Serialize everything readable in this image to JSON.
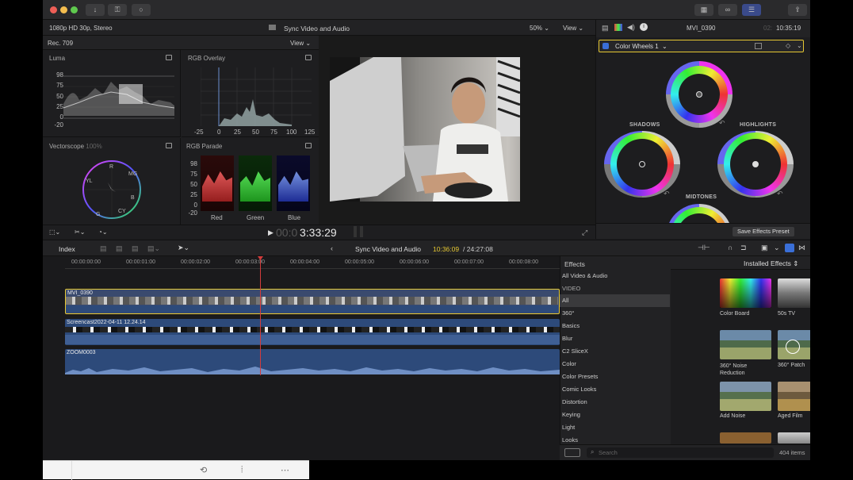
{
  "titlebar": {
    "toolbar_left_icons": [
      "download-icon",
      "key-icon",
      "circle-icon"
    ],
    "toolbar_right_icons": [
      "grid-icon",
      "glasses-icon",
      "sliders-icon",
      "share-icon"
    ]
  },
  "browser": {
    "format_label": "1080p HD 30p, Stereo",
    "project_title": "Sync Video and Audio",
    "zoom_label": "50%",
    "view_label": "View",
    "scopes_colorspace": "Rec. 709",
    "scopes_view_label": "View"
  },
  "scopes": {
    "luma": {
      "title": "Luma",
      "ticks": [
        "98",
        "75",
        "50",
        "25",
        "0",
        "-20"
      ]
    },
    "rgb_overlay": {
      "title": "RGB Overlay",
      "ticks": [
        "-25",
        "0",
        "25",
        "50",
        "75",
        "100",
        "125"
      ]
    },
    "vectorscope": {
      "title": "Vectorscope",
      "zoom": "100%",
      "targets": [
        "R",
        "MG",
        "B",
        "CY",
        "G",
        "YL"
      ]
    },
    "rgb_parade": {
      "title": "RGB Parade",
      "ticks": [
        "98",
        "75",
        "50",
        "25",
        "0",
        "-20"
      ],
      "channels": [
        "Red",
        "Green",
        "Blue"
      ]
    }
  },
  "playback": {
    "timecode_prefix": "00:0",
    "timecode_main": "3:33:29"
  },
  "inspector": {
    "clip_name": "MVI_0390",
    "duration": "10:35:19",
    "duration_prefix": "02:",
    "effect_name": "Color Wheels 1",
    "wheel_labels": {
      "shadows": "SHADOWS",
      "highlights": "HIGHLIGHTS",
      "midtones": "MIDTONES"
    },
    "save_preset_label": "Save Effects Preset"
  },
  "timeline_bar": {
    "index_label": "Index",
    "project_title": "Sync Video and Audio",
    "current_time": "10:36:09",
    "total_time": "/ 24:27:08"
  },
  "ruler": [
    "00:00:00:00",
    "00:00:01:00",
    "00:00:02:00",
    "00:00:03:00",
    "00:00:04:00",
    "00:00:05:00",
    "00:00:06:00",
    "00:00:07:00",
    "00:00:08:00"
  ],
  "clips": {
    "video": "MVI_0390",
    "screencast": "Screencast2022-04-11 12.24.14",
    "audio": "ZOOM0003"
  },
  "effects_browser": {
    "title": "Effects",
    "installed_label": "Installed Effects",
    "categories": [
      "All Video & Audio",
      "VIDEO",
      "All",
      "360°",
      "Basics",
      "Blur",
      "C2 SliceX",
      "Color",
      "Color Presets",
      "Comic Looks",
      "Distortion",
      "Keying",
      "Light",
      "Looks"
    ],
    "selected_category": "All",
    "thumbnails": [
      {
        "label": "Color Board",
        "kind": "rainbow"
      },
      {
        "label": "50s TV",
        "kind": "bw"
      },
      {
        "label": "360° Noise Reduction",
        "kind": "landscape"
      },
      {
        "label": "360° Patch",
        "kind": "landscape-patch"
      },
      {
        "label": "Add Noise",
        "kind": "landscape"
      },
      {
        "label": "Aged Film",
        "kind": "aged"
      }
    ],
    "search_placeholder": "Search",
    "item_count": "404 items"
  },
  "colors": {
    "accent_yellow": "#e6c832",
    "playhead_red": "#d43c3c",
    "clip_blue": "#2d4a7a",
    "selection_blue": "#3a6fd8"
  }
}
